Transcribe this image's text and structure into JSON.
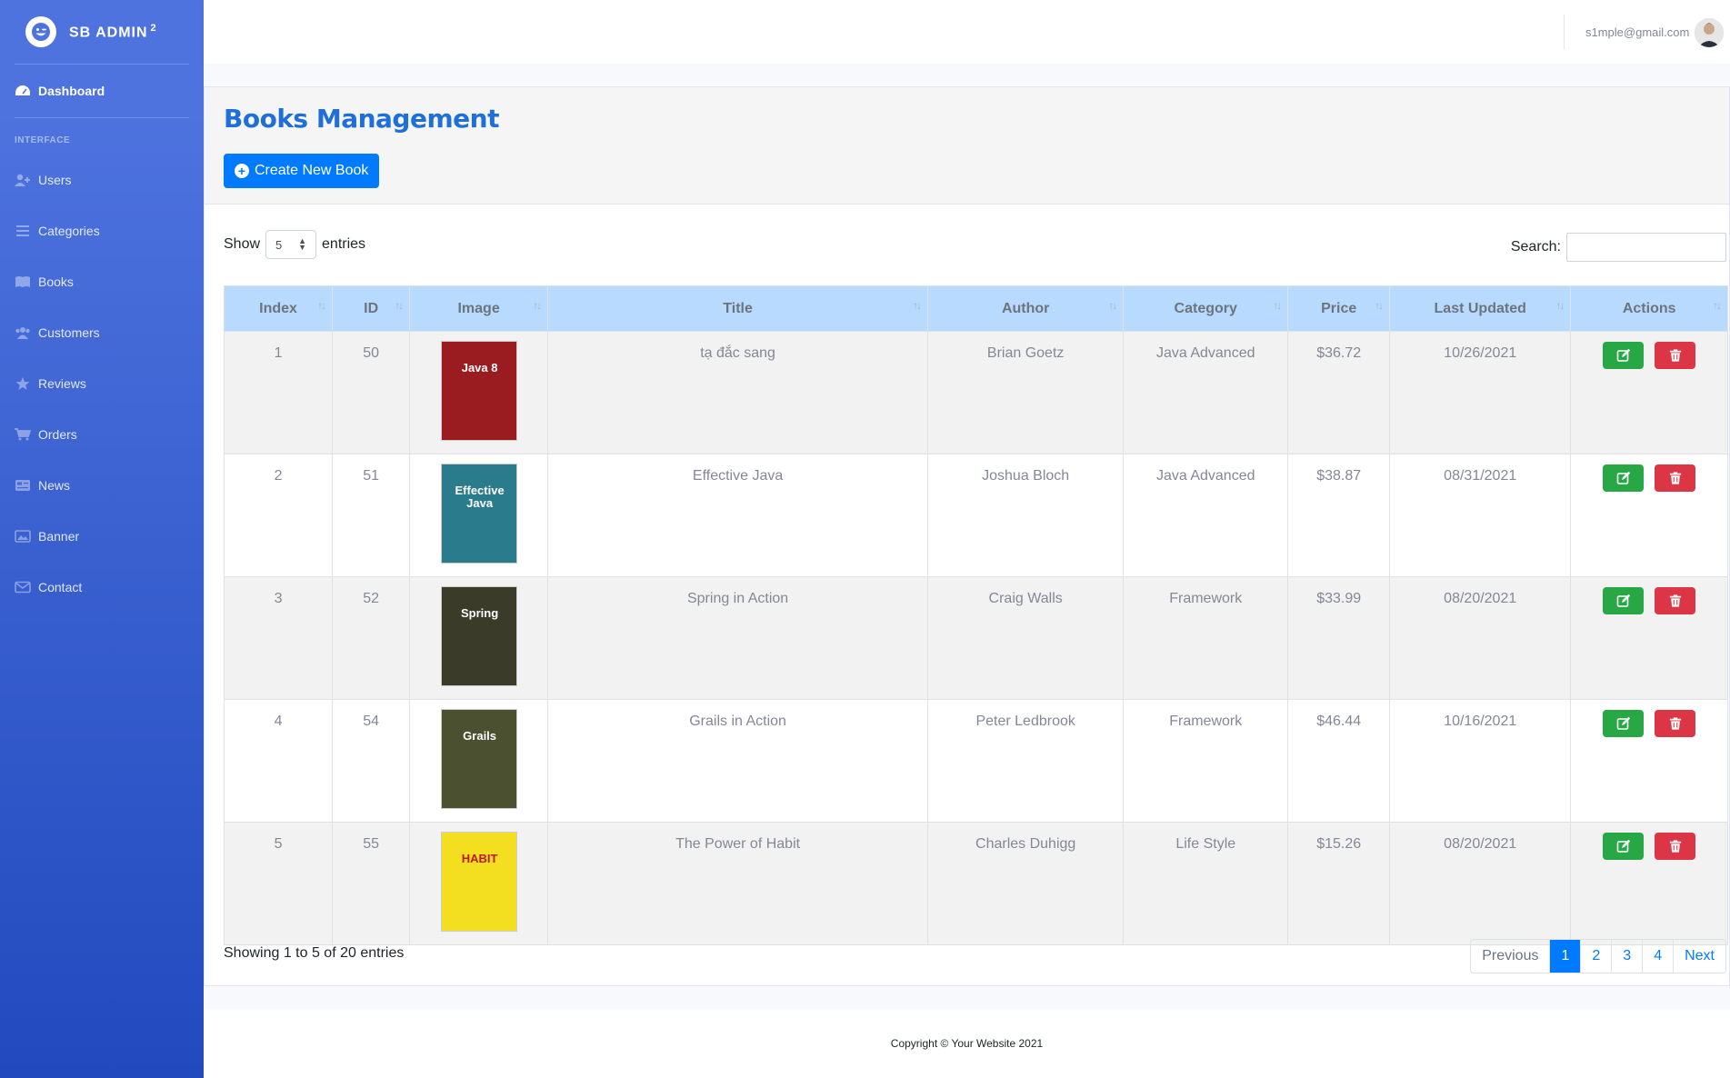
{
  "brand": {
    "name": "SB ADMIN",
    "sup": "2"
  },
  "sidebar": {
    "dashboard": "Dashboard",
    "heading": "INTERFACE",
    "items": [
      {
        "label": "Users",
        "icon": "user-plus-icon"
      },
      {
        "label": "Categories",
        "icon": "list-icon"
      },
      {
        "label": "Books",
        "icon": "book-icon"
      },
      {
        "label": "Customers",
        "icon": "users-icon"
      },
      {
        "label": "Reviews",
        "icon": "star-icon"
      },
      {
        "label": "Orders",
        "icon": "cart-icon"
      },
      {
        "label": "News",
        "icon": "newspaper-icon"
      },
      {
        "label": "Banner",
        "icon": "image-icon"
      },
      {
        "label": "Contact",
        "icon": "envelope-icon"
      }
    ]
  },
  "topbar": {
    "email": "s1mple@gmail.com"
  },
  "page": {
    "title": "Books Management",
    "create_label": "Create New Book",
    "show_label": "Show",
    "entries_value": "5",
    "entries_label": "entries",
    "search_label": "Search:",
    "info": "Showing 1 to 5 of 20 entries"
  },
  "table": {
    "headers": [
      "Index",
      "ID",
      "Image",
      "Title",
      "Author",
      "Category",
      "Price",
      "Last Updated",
      "Actions"
    ],
    "rows": [
      {
        "index": "1",
        "id": "50",
        "title": "tạ đắc sang",
        "author": "Brian Goetz",
        "category": "Java Advanced",
        "price": "$36.72",
        "updated": "10/26/2021",
        "cover": "Java 8",
        "cover_bg": "#9b1c20"
      },
      {
        "index": "2",
        "id": "51",
        "title": "Effective Java",
        "author": "Joshua Bloch",
        "category": "Java Advanced",
        "price": "$38.87",
        "updated": "08/31/2021",
        "cover": "Effective Java",
        "cover_bg": "#2a7b8c"
      },
      {
        "index": "3",
        "id": "52",
        "title": "Spring in Action",
        "author": "Craig Walls",
        "category": "Framework",
        "price": "$33.99",
        "updated": "08/20/2021",
        "cover": "Spring",
        "cover_bg": "#3b3b2a"
      },
      {
        "index": "4",
        "id": "54",
        "title": "Grails in Action",
        "author": "Peter Ledbrook",
        "category": "Framework",
        "price": "$46.44",
        "updated": "10/16/2021",
        "cover": "Grails",
        "cover_bg": "#4a5030"
      },
      {
        "index": "5",
        "id": "55",
        "title": "The Power of Habit",
        "author": "Charles Duhigg",
        "category": "Life Style",
        "price": "$15.26",
        "updated": "08/20/2021",
        "cover": "HABIT",
        "cover_bg": "#f3df1f"
      }
    ]
  },
  "pager": {
    "prev": "Previous",
    "pages": [
      "1",
      "2",
      "3",
      "4"
    ],
    "next": "Next"
  },
  "footer": {
    "copyright": "Copyright © Your Website 2021"
  }
}
